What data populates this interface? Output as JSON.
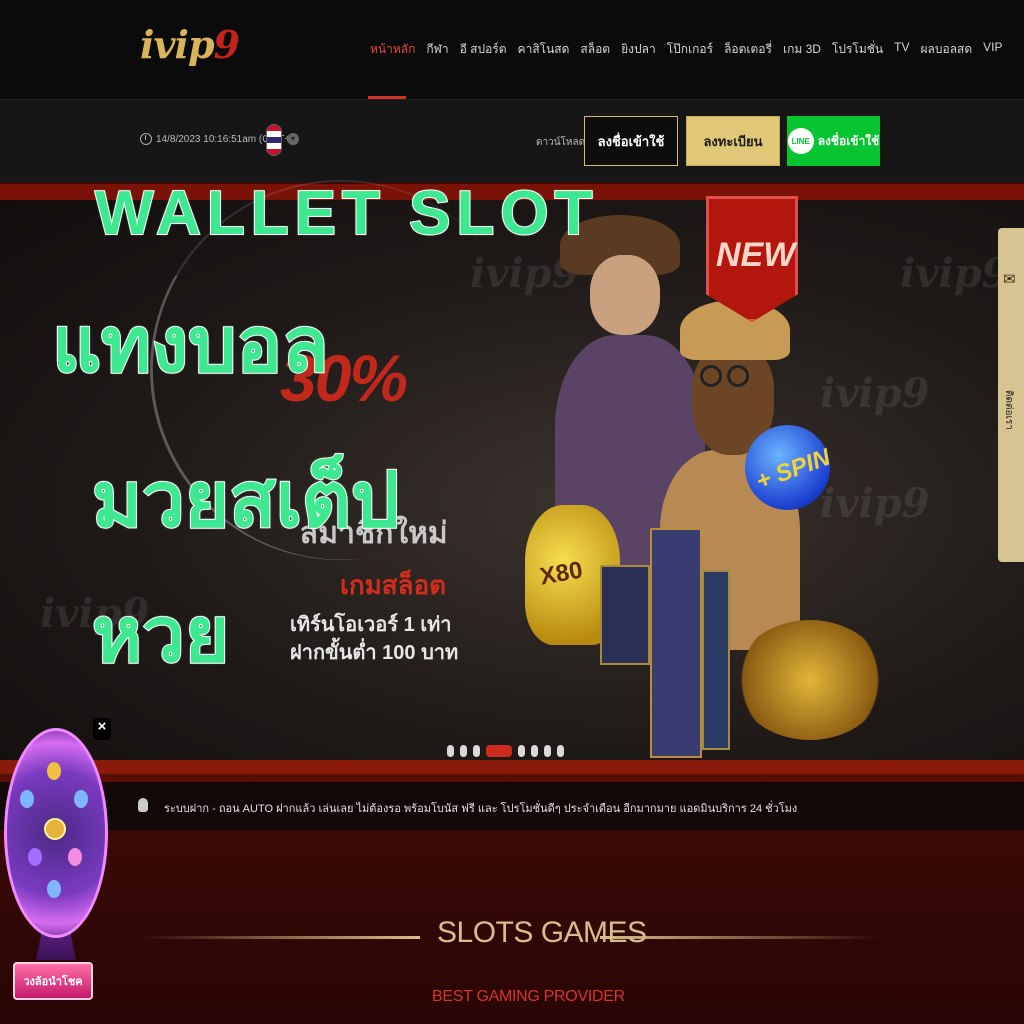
{
  "logo": {
    "main": "ivip",
    "accent": "9"
  },
  "nav": {
    "items": [
      {
        "label": "หน้าหลัก",
        "active": true
      },
      {
        "label": "กีฬา"
      },
      {
        "label": "อี สปอร์ต"
      },
      {
        "label": "คาสิโนสด"
      },
      {
        "label": "สล็อต"
      },
      {
        "label": "ยิงปลา"
      },
      {
        "label": "โป๊กเกอร์"
      },
      {
        "label": "ล็อตเตอรี่"
      },
      {
        "label": "เกม 3D"
      },
      {
        "label": "โปรโมชั่น"
      },
      {
        "label": "TV"
      },
      {
        "label": "ผลบอลสด"
      },
      {
        "label": "VIP"
      }
    ]
  },
  "subbar": {
    "datetime": "14/8/2023 10:16:51am (GMT+8)",
    "download_label": "ดาวน์โหลด",
    "login_label": "ลงชื่อเข้าใช้",
    "register_label": "ลงทะเบียน",
    "line_badge": "LINE",
    "line_login_label": "ลงชื่อเข้าใช้"
  },
  "overlay": {
    "line1": "WALLET SLOT",
    "line2": "แทงบอล",
    "line3": "มวยสเต็ป",
    "line4": "หวย"
  },
  "banner": {
    "percent": "30%",
    "subtitle": "สมาชิกใหม่",
    "game": "เกมสล็อต",
    "line1": "เทิร์นโอเวอร์ 1 เท่า",
    "line2": "ฝากขั้นต่ำ 100 บาท",
    "new_badge": "NEW",
    "spin_text": "+ SPIN",
    "bag_text": "X80",
    "bg_logo": "ivip9",
    "slide_count": 8,
    "active_slide": 3
  },
  "side_contact": {
    "label": "ติดต่อเรา",
    "icon": "envelope-icon"
  },
  "ticker": {
    "icon": "bell-icon",
    "text": "ระบบฝาก - ถอน AUTO  ฝากแล้ว เล่นเลย ไม่ต้องรอ พร้อมโบนัส ฟรี และ โปรโมชั่นดีๆ ประจำเดือน อีกมากมาย แอดมินบริการ 24 ชั่วโมง"
  },
  "slots": {
    "title": "SLOTS GAMES",
    "subtitle": "BEST GAMING PROVIDER"
  },
  "wheel": {
    "close_label": "×",
    "label": "วงล้อนำโชค"
  },
  "colors": {
    "accent_red": "#d23327",
    "gold": "#e0c878",
    "line_green": "#07c431",
    "overlay_green": "#3ee890"
  }
}
